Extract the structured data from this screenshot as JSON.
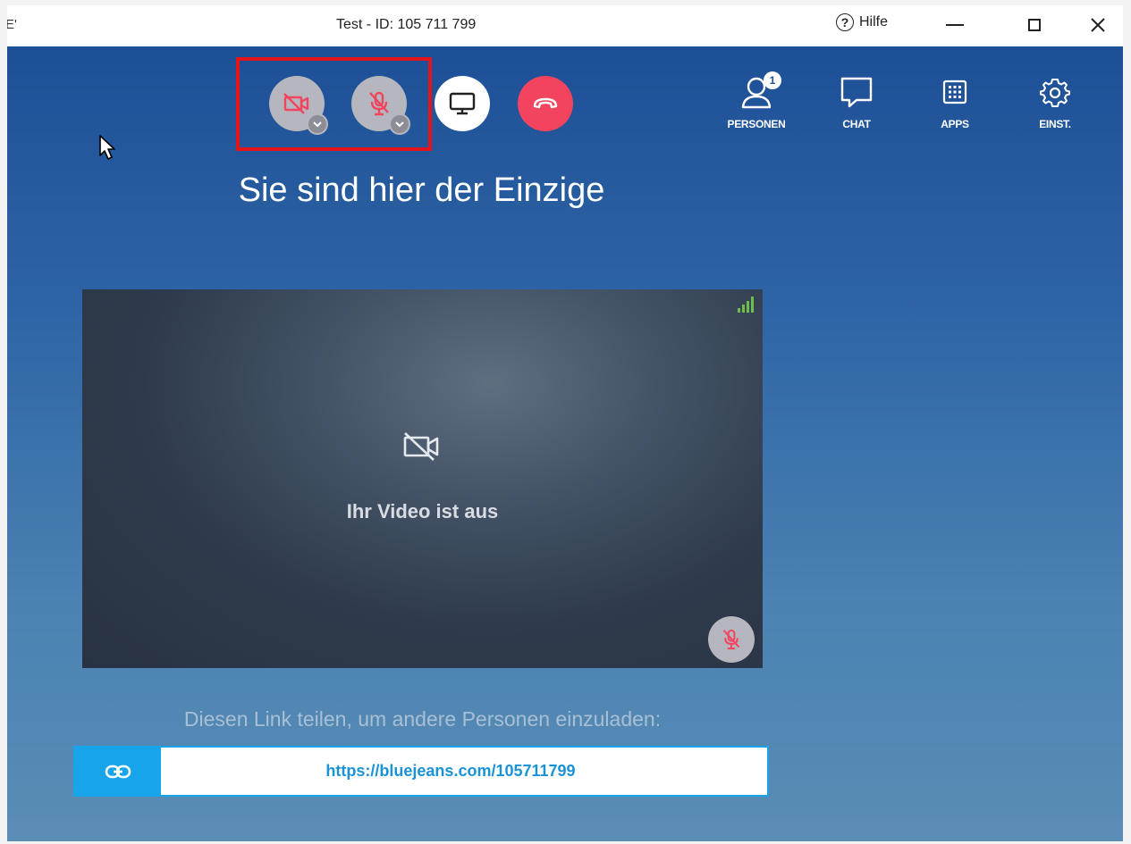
{
  "window": {
    "title_left": "E'",
    "title": "Test - ID: 105 711 799",
    "help_icon": "question-circle-icon",
    "help_label": "Hilfe",
    "controls": [
      "minimize",
      "maximize",
      "close"
    ]
  },
  "toolbar": {
    "camera": {
      "icon": "video-off-icon",
      "state": "off",
      "color": "#b6b6be"
    },
    "microphone": {
      "icon": "mic-off-icon",
      "state": "muted",
      "color": "#b6b6be"
    },
    "screen_share": {
      "icon": "monitor-icon",
      "color": "#ffffff"
    },
    "hang_up": {
      "icon": "phone-hangup-icon",
      "color": "#f2445e"
    },
    "mute_icon_color": "#f2445e"
  },
  "nav": {
    "personen": {
      "label": "PERSONEN",
      "icon": "person-icon",
      "badge": "1"
    },
    "chat": {
      "label": "CHAT",
      "icon": "chat-bubble-icon"
    },
    "apps": {
      "label": "APPS",
      "icon": "apps-grid-icon"
    },
    "einst": {
      "label": "EINST.",
      "icon": "gear-icon"
    }
  },
  "main": {
    "heading": "Sie sind hier der Einzige",
    "video": {
      "status_icon": "video-off-icon",
      "status_text": "Ihr Video ist aus",
      "signal_icon": "signal-strength-icon",
      "signal_color": "#6cc04a",
      "mic_icon": "mic-off-icon"
    },
    "share": {
      "text": "Diesen Link teilen, um andere Personen einzuladen:",
      "link_icon": "link-icon",
      "url": "https://bluejeans.com/105711799",
      "accent": "#18a4e8"
    }
  },
  "colors": {
    "background_top": "#1d4f96",
    "background_bottom": "#5b8db5",
    "highlight": "#e4141a"
  }
}
